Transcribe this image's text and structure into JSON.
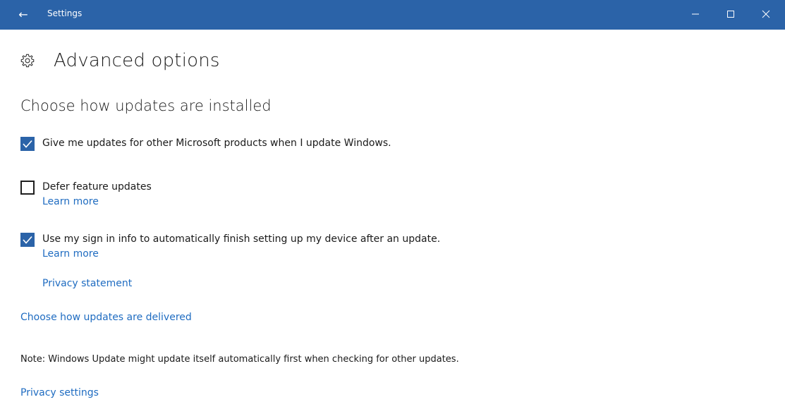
{
  "window": {
    "title": "Settings",
    "controls": {
      "minimize": "—",
      "maximize": "☐",
      "close": "✕"
    },
    "back_icon": "←"
  },
  "page": {
    "icon": "gear-icon",
    "title": "Advanced options"
  },
  "section": {
    "title": "Choose how updates are installed"
  },
  "options": [
    {
      "label": "Give me updates for other Microsoft products when I update Windows.",
      "checked": true
    },
    {
      "label": "Defer feature updates",
      "checked": false,
      "link": "Learn more"
    },
    {
      "label": "Use my sign in info to automatically finish setting up my device after an update.",
      "checked": true,
      "link": "Learn more",
      "extra_link": "Privacy statement"
    }
  ],
  "links": {
    "delivery": "Choose how updates are delivered",
    "privacy_settings": "Privacy settings"
  },
  "note": "Note: Windows Update might update itself automatically first when checking for other updates.",
  "colors": {
    "accent": "#2b63a8",
    "link": "#1f6cc1"
  }
}
